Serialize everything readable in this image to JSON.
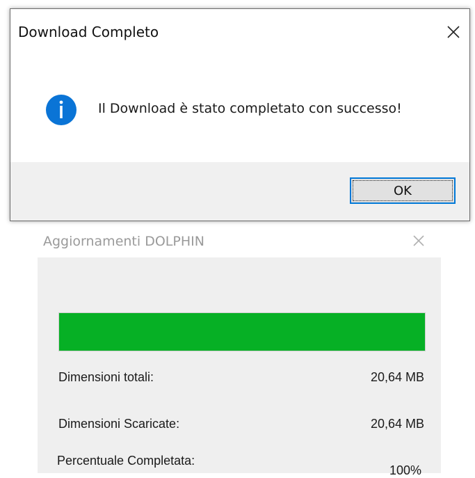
{
  "background_window": {
    "title": "Aggiornamenti DOLPHIN",
    "close_icon": "close-icon",
    "progress_fraction": 1.0,
    "progress_color": "#06b025",
    "rows": [
      {
        "label": "Dimensioni totali:",
        "value": "20,64 MB"
      },
      {
        "label": "Dimensioni Scaricate:",
        "value": "20,64 MB"
      },
      {
        "label": "Percentuale Completata:",
        "value": "100%"
      }
    ]
  },
  "dialog": {
    "title": "Download Completo",
    "close_icon": "close-icon",
    "icon": "info-icon",
    "icon_color": "#0a74d6",
    "message": "Il Download è stato completato con successo!",
    "ok_label": "OK",
    "accent_color": "#0078d7"
  }
}
